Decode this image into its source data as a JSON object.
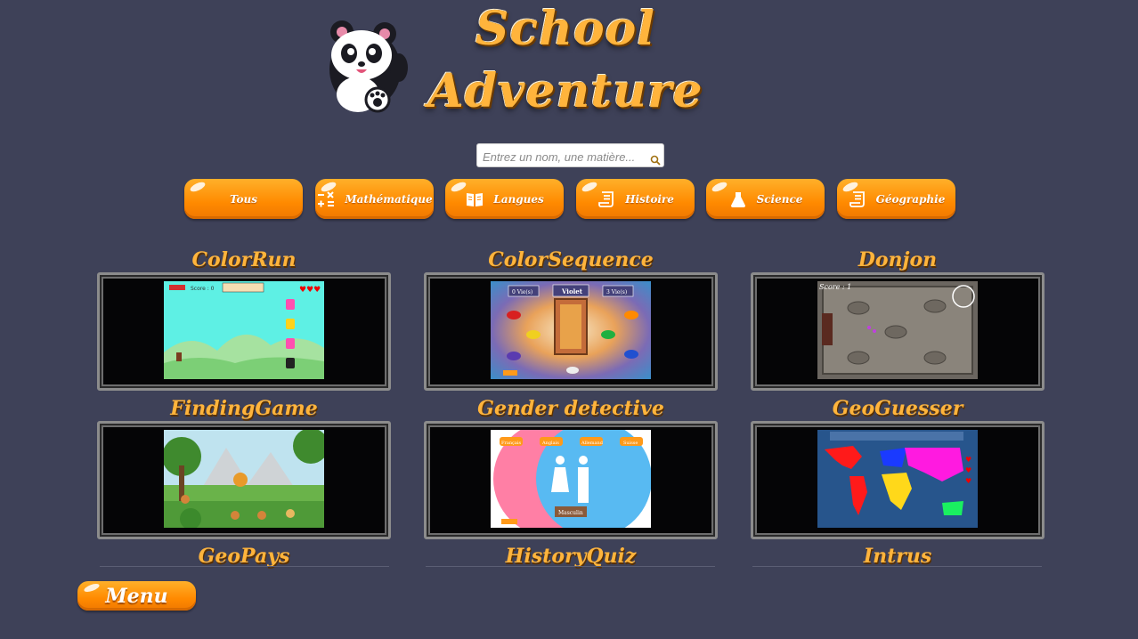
{
  "header": {
    "title_line1": "School",
    "title_line2": "Adventure"
  },
  "search": {
    "placeholder": "Entrez un nom, une matière...",
    "value": ""
  },
  "categories": [
    {
      "label": "Tous",
      "icon": "none"
    },
    {
      "label": "Mathématique",
      "icon": "math-operators-icon"
    },
    {
      "label": "Langues",
      "icon": "book-icon"
    },
    {
      "label": "Histoire",
      "icon": "scroll-icon"
    },
    {
      "label": "Science",
      "icon": "flask-icon"
    },
    {
      "label": "Géographie",
      "icon": "map-scroll-icon"
    }
  ],
  "games": [
    {
      "title": "ColorRun"
    },
    {
      "title": "ColorSequence"
    },
    {
      "title": "Donjon"
    },
    {
      "title": "FindingGame"
    },
    {
      "title": "Gender detective"
    },
    {
      "title": "GeoGuesser"
    },
    {
      "title": "GeoPays"
    },
    {
      "title": "HistoryQuiz"
    },
    {
      "title": "Intrus"
    }
  ],
  "thumbnails": {
    "colorrun_score": "Score : 0",
    "colorsequence_color": "Violet",
    "colorsequence_left": "0 Vie(s)",
    "colorsequence_right": "3 Vie(s)",
    "donjon_score": "Score : 1",
    "gender_label": "Masculin",
    "gender_options": [
      "Français",
      "Anglais",
      "Allemand",
      "Suisse"
    ]
  },
  "footer": {
    "menu_label": "Menu"
  },
  "colors": {
    "background": "#3e4158",
    "accent": "#ff8a00",
    "title": "#ffb43c"
  }
}
